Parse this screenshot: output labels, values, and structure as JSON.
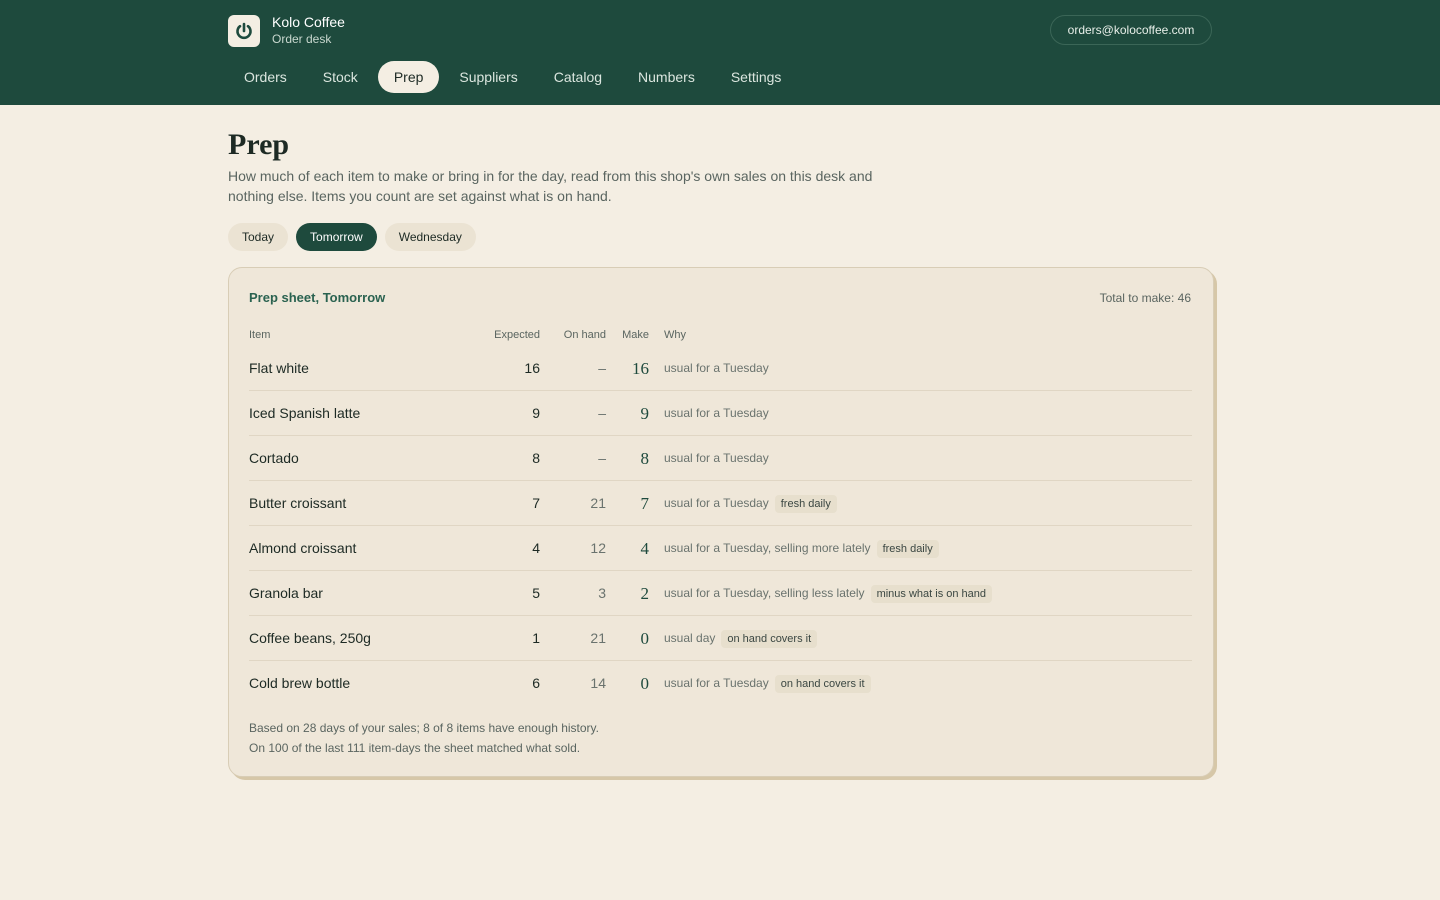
{
  "app": {
    "name": "Kolo Coffee",
    "subtitle": "Order desk",
    "account": "orders@kolocoffee.com"
  },
  "nav": [
    {
      "label": "Orders",
      "active": false
    },
    {
      "label": "Stock",
      "active": false
    },
    {
      "label": "Prep",
      "active": true
    },
    {
      "label": "Suppliers",
      "active": false
    },
    {
      "label": "Catalog",
      "active": false
    },
    {
      "label": "Numbers",
      "active": false
    },
    {
      "label": "Settings",
      "active": false
    }
  ],
  "page": {
    "title": "Prep",
    "description": "How much of each item to make or bring in for the day, read from this shop's own sales on this desk and nothing else. Items you count are set against what is on hand."
  },
  "day_tabs": [
    {
      "label": "Today",
      "active": false
    },
    {
      "label": "Tomorrow",
      "active": true
    },
    {
      "label": "Wednesday",
      "active": false
    }
  ],
  "sheet": {
    "title": "Prep sheet, Tomorrow",
    "total": "Total to make: 46",
    "columns": {
      "item": "Item",
      "expected": "Expected",
      "on_hand": "On hand",
      "make": "Make",
      "why": "Why"
    },
    "rows": [
      {
        "item": "Flat white",
        "expected": "16",
        "on_hand": "–",
        "make": "16",
        "why": "usual for a Tuesday",
        "tag": ""
      },
      {
        "item": "Iced Spanish latte",
        "expected": "9",
        "on_hand": "–",
        "make": "9",
        "why": "usual for a Tuesday",
        "tag": ""
      },
      {
        "item": "Cortado",
        "expected": "8",
        "on_hand": "–",
        "make": "8",
        "why": "usual for a Tuesday",
        "tag": ""
      },
      {
        "item": "Butter croissant",
        "expected": "7",
        "on_hand": "21",
        "make": "7",
        "why": "usual for a Tuesday",
        "tag": "fresh daily"
      },
      {
        "item": "Almond croissant",
        "expected": "4",
        "on_hand": "12",
        "make": "4",
        "why": "usual for a Tuesday, selling more lately",
        "tag": "fresh daily"
      },
      {
        "item": "Granola bar",
        "expected": "5",
        "on_hand": "3",
        "make": "2",
        "why": "usual for a Tuesday, selling less lately",
        "tag": "minus what is on hand"
      },
      {
        "item": "Coffee beans, 250g",
        "expected": "1",
        "on_hand": "21",
        "make": "0",
        "why": "usual day",
        "tag": "on hand covers it"
      },
      {
        "item": "Cold brew bottle",
        "expected": "6",
        "on_hand": "14",
        "make": "0",
        "why": "usual for a Tuesday",
        "tag": "on hand covers it"
      }
    ],
    "footer": {
      "line1": "Based on 28 days of your sales; 8 of 8 items have enough history.",
      "line2": "On 100 of the last 111 item-days the sheet matched what sold."
    }
  },
  "colors": {
    "header_bg": "#1e4a3d",
    "page_bg": "#f4eee3",
    "card_bg": "#efe7d9",
    "accent": "#2a6250"
  },
  "icons": {
    "logo": "power-ring-icon"
  }
}
